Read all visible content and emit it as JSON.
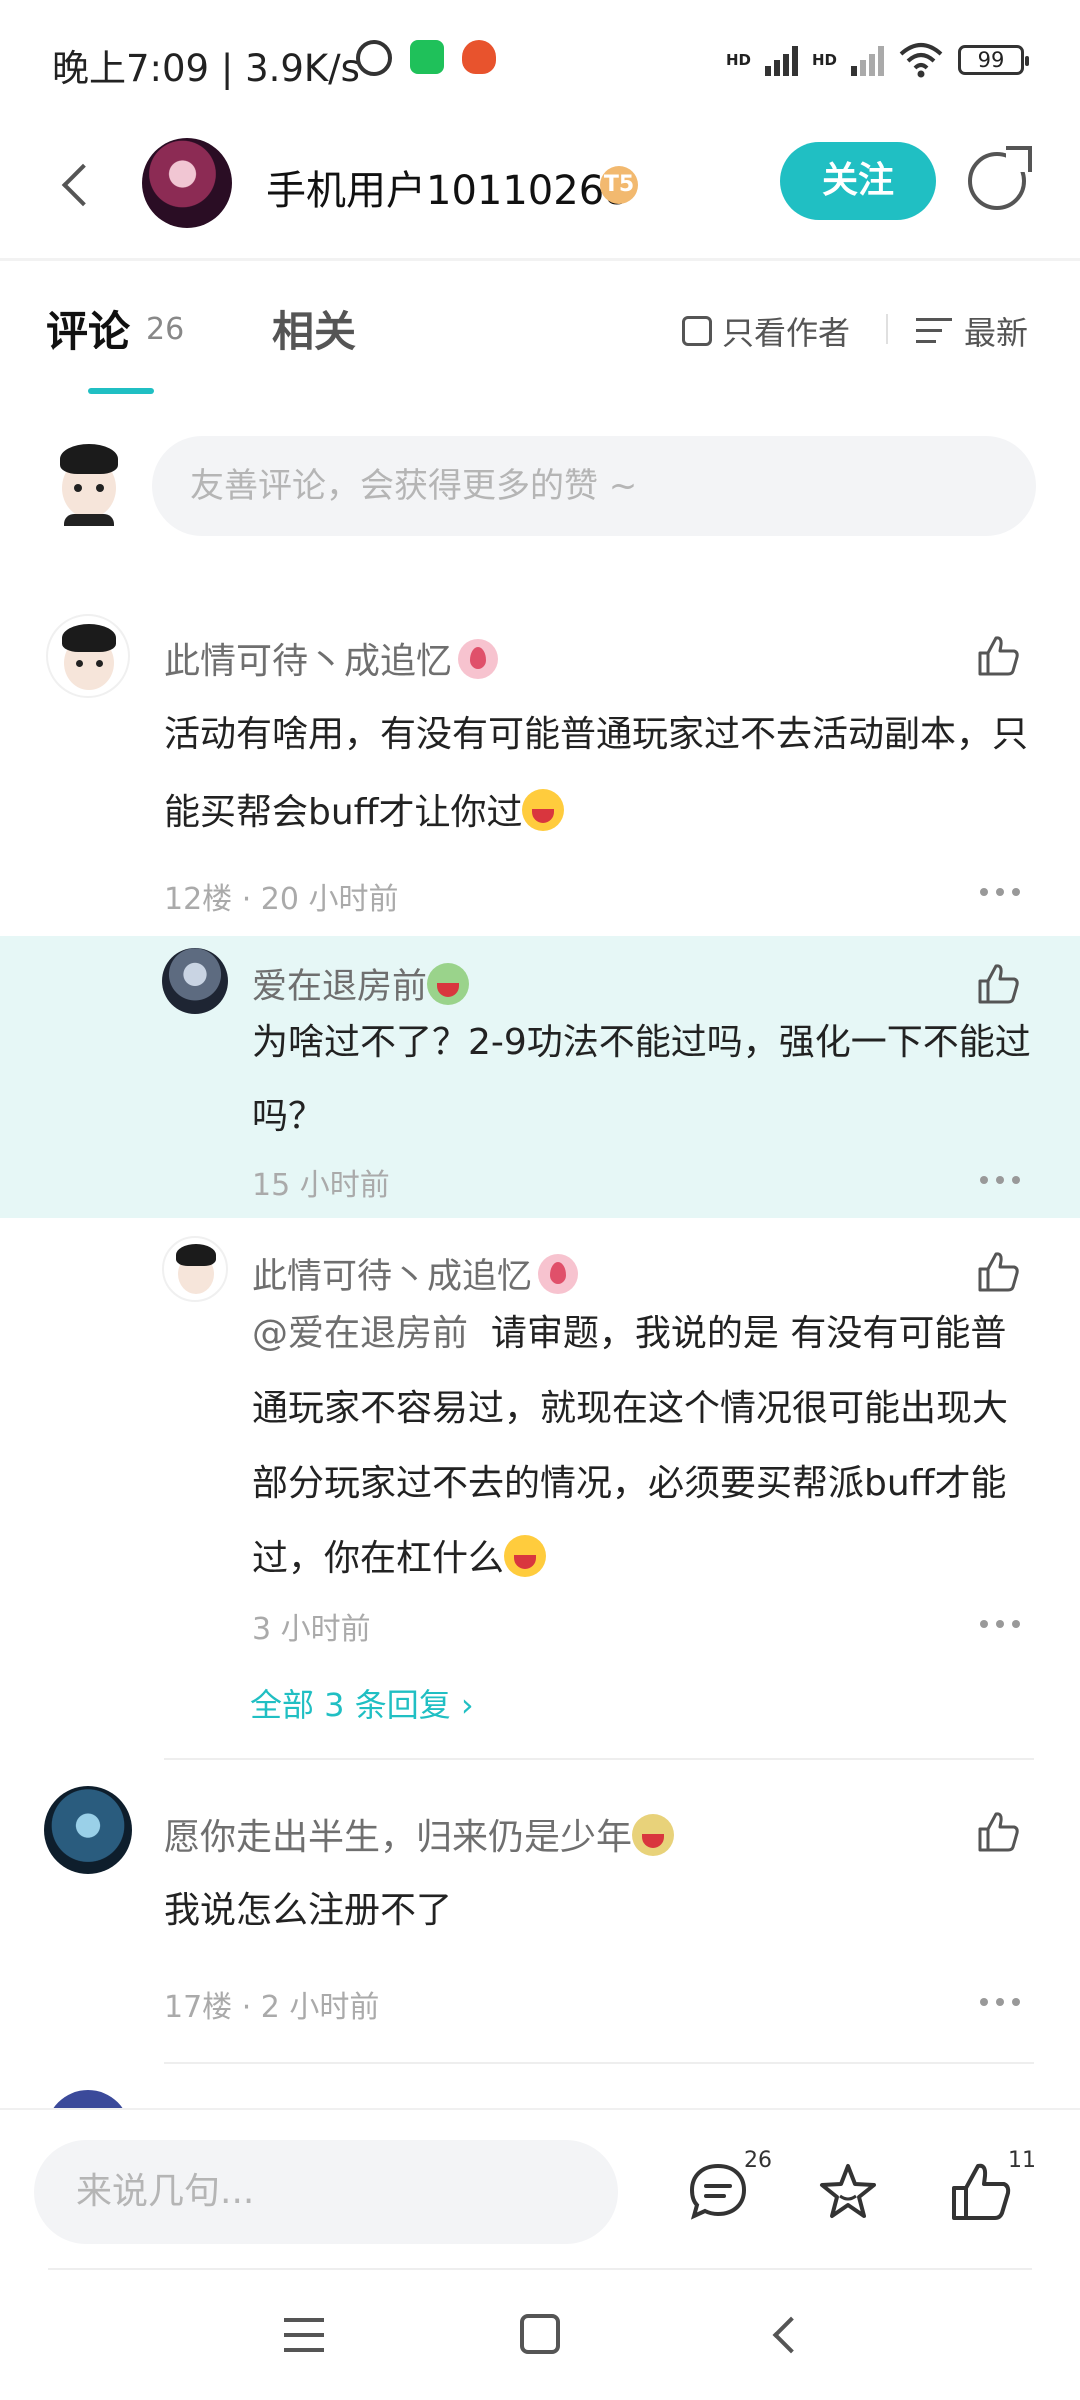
{
  "status_bar": {
    "time_and_speed": "晚上7:09 | 3.9K/s",
    "network_labels": [
      "HD",
      "HD"
    ],
    "battery": "99"
  },
  "header": {
    "username": "手机用户10110268",
    "level_badge": "T5",
    "follow_label": "关注"
  },
  "tabs": {
    "comments_label": "评论",
    "comments_count": "26",
    "related_label": "相关",
    "author_only_label": "只看作者",
    "sort_label": "最新"
  },
  "comment_box": {
    "placeholder": "友善评论，会获得更多的赞 ~"
  },
  "comments": [
    {
      "name": "此情可待丶成追忆",
      "text": "活动有啥用，有没有可能普通玩家过不去活动副本，只能买帮会buff才让你过",
      "meta": "12楼 · 20 小时前"
    },
    {
      "name": "愿你走出半生，归来仍是少年",
      "text": "我说怎么注册不了",
      "meta": "17楼 · 2 小时前"
    }
  ],
  "replies": [
    {
      "name": "爱在退房前",
      "text": "为啥过不了？2-9功法不能过吗，强化一下不能过吗？",
      "meta": "15 小时前"
    },
    {
      "name": "此情可待丶成追忆",
      "mention": "@爱在退房前",
      "text": "请审题，我说的是 有没有可能普通玩家不容易过，就现在这个情况很可能出现大部分玩家过不去的情况，必须要买帮派buff才能过，你在杠什么",
      "meta": "3 小时前"
    }
  ],
  "view_all_replies": "全部 3 条回复",
  "bottom_bar": {
    "input_placeholder": "来说几句...",
    "comment_count": "26",
    "like_count": "11"
  }
}
